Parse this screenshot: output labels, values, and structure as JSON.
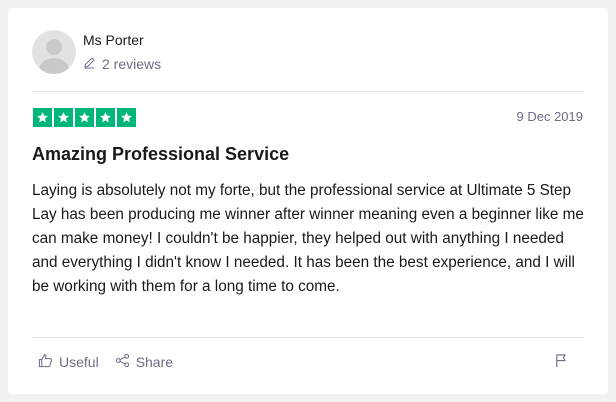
{
  "reviewer": {
    "name": "Ms Porter",
    "reviews_count": "2 reviews"
  },
  "review": {
    "rating": 5,
    "date": "9 Dec 2019",
    "title": "Amazing Professional Service",
    "body": "Laying is absolutely not my forte, but the professional service at Ultimate 5 Step Lay has been producing me winner after winner meaning even a beginner like me can make money! I couldn't be happier, they helped out with anything I needed and everything I didn't know I needed. It has been the best experience, and I will be working with them for a long time to come."
  },
  "actions": {
    "useful_label": "Useful",
    "share_label": "Share"
  },
  "colors": {
    "star_fill": "#00b67a",
    "muted_text": "#6c6c85"
  },
  "icons": {
    "avatar": "person-silhouette-icon",
    "reviews": "pencil-icon",
    "star": "star-icon",
    "useful": "thumbs-up-icon",
    "share": "share-icon",
    "report": "flag-icon"
  }
}
